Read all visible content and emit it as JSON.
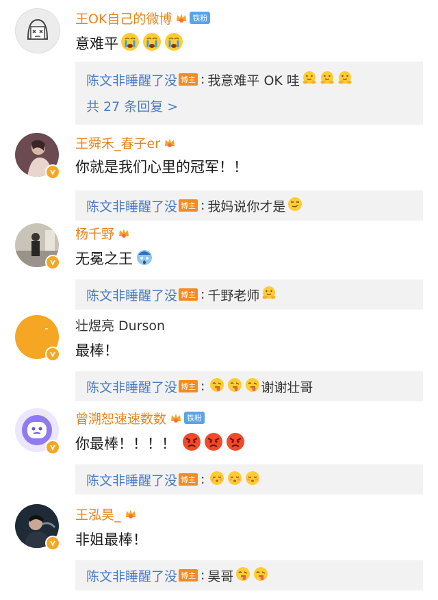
{
  "comments": [
    {
      "name": "王OK自己的微博",
      "fan_badge": "铁粉",
      "text": "意难平",
      "emojis": [
        "crying-emoji",
        "crying-emoji",
        "crying-emoji"
      ],
      "reply": {
        "name": "陈文非睡醒了没",
        "badge": "博主",
        "text": "我意难平 OK 哇",
        "emojis": [
          "hug-emoji",
          "hug-emoji",
          "hug-emoji"
        ]
      },
      "more": "共 27 条回复 >"
    },
    {
      "name": "王舜禾_春子er",
      "text": "你就是我们心里的冠军！！",
      "reply": {
        "name": "陈文非睡醒了没",
        "badge": "博主",
        "text": "我妈说你才是",
        "emojis": [
          "smirk-emoji"
        ]
      }
    },
    {
      "name": "杨千野",
      "text": "无冕之王",
      "emojis": [
        "shock-emoji"
      ],
      "reply": {
        "name": "陈文非睡醒了没",
        "badge": "博主",
        "text": "千野老师",
        "emojis": [
          "hug-emoji"
        ]
      }
    },
    {
      "name": "壮煜亮 Durson",
      "text": "最棒！",
      "reply": {
        "name": "陈文非睡醒了没",
        "badge": "博主",
        "text": "谢谢壮哥",
        "emojis_before": [
          "tongue-emoji",
          "tongue-emoji",
          "tongue-emoji"
        ]
      }
    },
    {
      "name": "曾溯恕速速数数",
      "fan_badge": "铁粉",
      "text": "你最棒！！！！",
      "emojis": [
        "angry-emoji",
        "angry-emoji",
        "angry-emoji"
      ],
      "reply": {
        "name": "陈文非睡醒了没",
        "badge": "博主",
        "text": "",
        "emojis": [
          "shy-emoji",
          "shy-emoji",
          "shy-emoji"
        ]
      }
    },
    {
      "name": "王泓昊_",
      "text": "非姐最棒！",
      "reply": {
        "name": "陈文非睡醒了没",
        "badge": "博主",
        "text": "昊哥",
        "emojis": [
          "tongue-emoji",
          "tongue-emoji"
        ]
      }
    }
  ],
  "colors": {
    "username": "#e8841a",
    "reply_name": "#4a7bc0",
    "blogger_badge": "#f58a1f",
    "fan_badge": "#5aa3e8",
    "verified": "#f5a623"
  }
}
